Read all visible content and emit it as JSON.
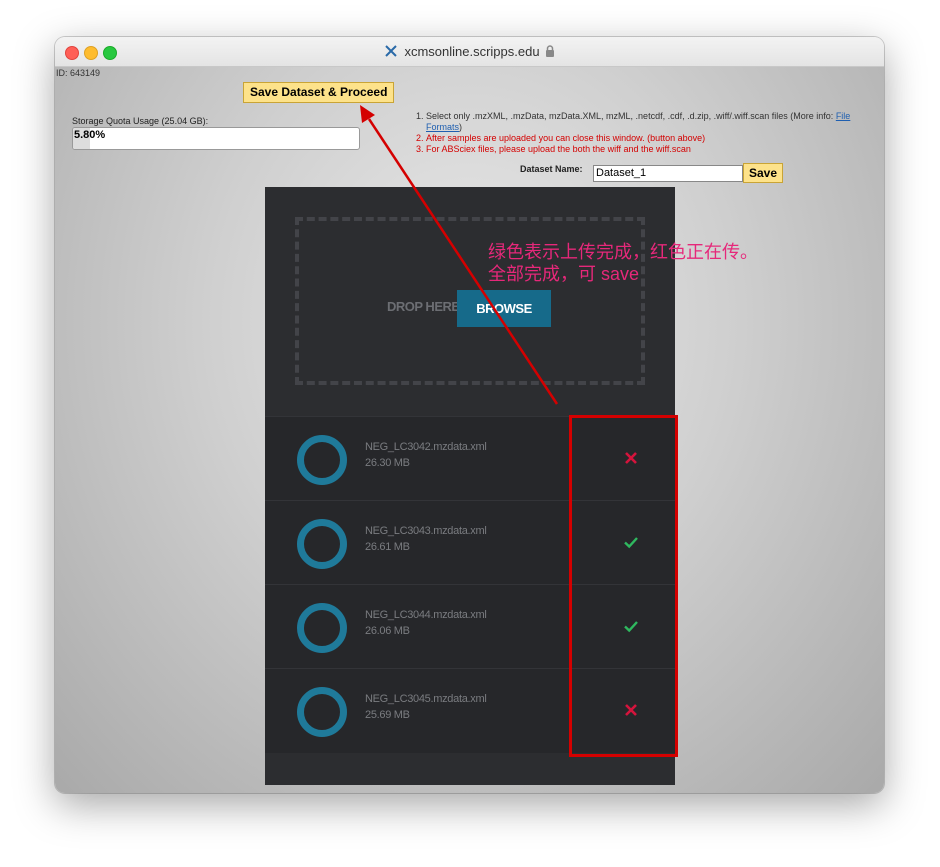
{
  "window": {
    "title": "xcmsonline.scripps.edu"
  },
  "page": {
    "id_text": "ID: 643149",
    "save_proceed_label": "Save Dataset & Proceed",
    "quota_label": "Storage Quota Usage (25.04 GB):",
    "quota_percent_text": "5.80%",
    "quota_fraction": 0.058,
    "instructions": {
      "item1_text": "Select only .mzXML, .mzData, mzData.XML, mzML, .netcdf, .cdf, .d.zip, .wiff/.wiff.scan files (More info: ",
      "item1_link": "File Formats",
      "item1_end": ")",
      "item2": "After samples are uploaded you can close this window. (button above)",
      "item3": "For ABSciex files, please upload the both the wiff and the wiff.scan"
    },
    "dataset_name_label": "Dataset Name:",
    "dataset_name_value": "Dataset_1",
    "dataset_save_label": "Save"
  },
  "uploader": {
    "drop_label": "DROP HERE",
    "browse_label": "BROWSE",
    "files": [
      {
        "name": "NEG_LC3042.mzdata.xml",
        "size": "26.30 MB",
        "status": "uploading",
        "status_icon": "cross-icon"
      },
      {
        "name": "NEG_LC3043.mzdata.xml",
        "size": "26.61 MB",
        "status": "complete",
        "status_icon": "check-icon"
      },
      {
        "name": "NEG_LC3044.mzdata.xml",
        "size": "26.06 MB",
        "status": "complete",
        "status_icon": "check-icon"
      },
      {
        "name": "NEG_LC3045.mzdata.xml",
        "size": "25.69 MB",
        "status": "uploading",
        "status_icon": "cross-icon"
      }
    ]
  },
  "annotation": {
    "line1": "绿色表示上传完成，红色正在传。",
    "line2": "全部完成，可 save"
  },
  "colors": {
    "check": "#2fb85f",
    "cross": "#d4143c",
    "annotation": "#e6287a",
    "annotation_box": "#d40000",
    "accent": "#166a8a"
  }
}
